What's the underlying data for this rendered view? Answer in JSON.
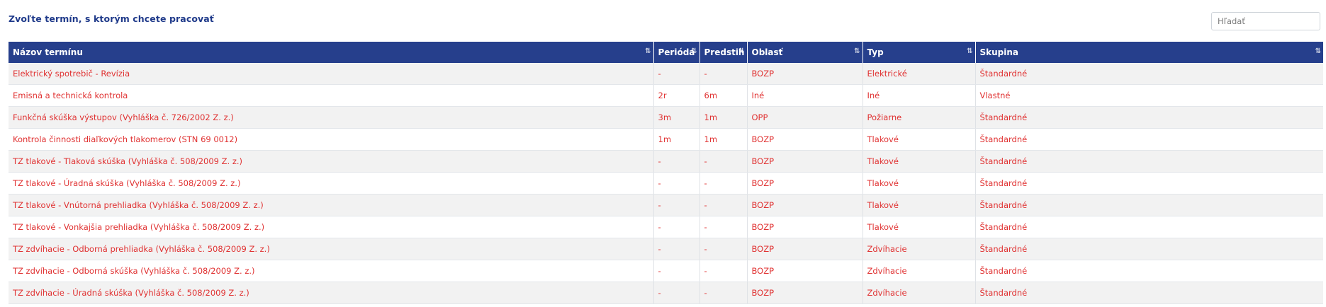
{
  "heading": "Zvoľte termín, s ktorým chcete pracovať",
  "search": {
    "placeholder": "Hľadať"
  },
  "sort_icon": "⇅",
  "columns": [
    "Názov termínu",
    "Perióda",
    "Predstih",
    "Oblasť",
    "Typ",
    "Skupina"
  ],
  "rows": [
    [
      "Elektrický spotrebič - Revízia",
      "-",
      "-",
      "BOZP",
      "Elektrické",
      "Štandardné"
    ],
    [
      "Emisná a technická kontrola",
      "2r",
      "6m",
      "Iné",
      "Iné",
      "Vlastné"
    ],
    [
      "Funkčná skúška výstupov (Vyhláška č. 726/2002 Z. z.)",
      "3m",
      "1m",
      "OPP",
      "Požiarne",
      "Štandardné"
    ],
    [
      "Kontrola činnosti diaľkových tlakomerov (STN 69 0012)",
      "1m",
      "1m",
      "BOZP",
      "Tlakové",
      "Štandardné"
    ],
    [
      "TZ tlakové - Tlaková skúška (Vyhláška č. 508/2009 Z. z.)",
      "-",
      "-",
      "BOZP",
      "Tlakové",
      "Štandardné"
    ],
    [
      "TZ tlakové - Úradná skúška (Vyhláška č. 508/2009 Z. z.)",
      "-",
      "-",
      "BOZP",
      "Tlakové",
      "Štandardné"
    ],
    [
      "TZ tlakové - Vnútorná prehliadka (Vyhláška č. 508/2009 Z. z.)",
      "-",
      "-",
      "BOZP",
      "Tlakové",
      "Štandardné"
    ],
    [
      "TZ tlakové - Vonkajšia prehliadka (Vyhláška č. 508/2009 Z. z.)",
      "-",
      "-",
      "BOZP",
      "Tlakové",
      "Štandardné"
    ],
    [
      "TZ zdvíhacie - Odborná prehliadka (Vyhláška č. 508/2009 Z. z.)",
      "-",
      "-",
      "BOZP",
      "Zdvíhacie",
      "Štandardné"
    ],
    [
      "TZ zdvíhacie - Odborná skúška (Vyhláška č. 508/2009 Z. z.)",
      "-",
      "-",
      "BOZP",
      "Zdvíhacie",
      "Štandardné"
    ],
    [
      "TZ zdvíhacie - Úradná skúška (Vyhláška č. 508/2009 Z. z.)",
      "-",
      "-",
      "BOZP",
      "Zdvíhacie",
      "Štandardné"
    ]
  ],
  "colors": {
    "header_bg": "#263f8c",
    "heading_text": "#1f3a8a",
    "cell_text": "#e03131",
    "row_stripe": "#f2f2f2"
  }
}
